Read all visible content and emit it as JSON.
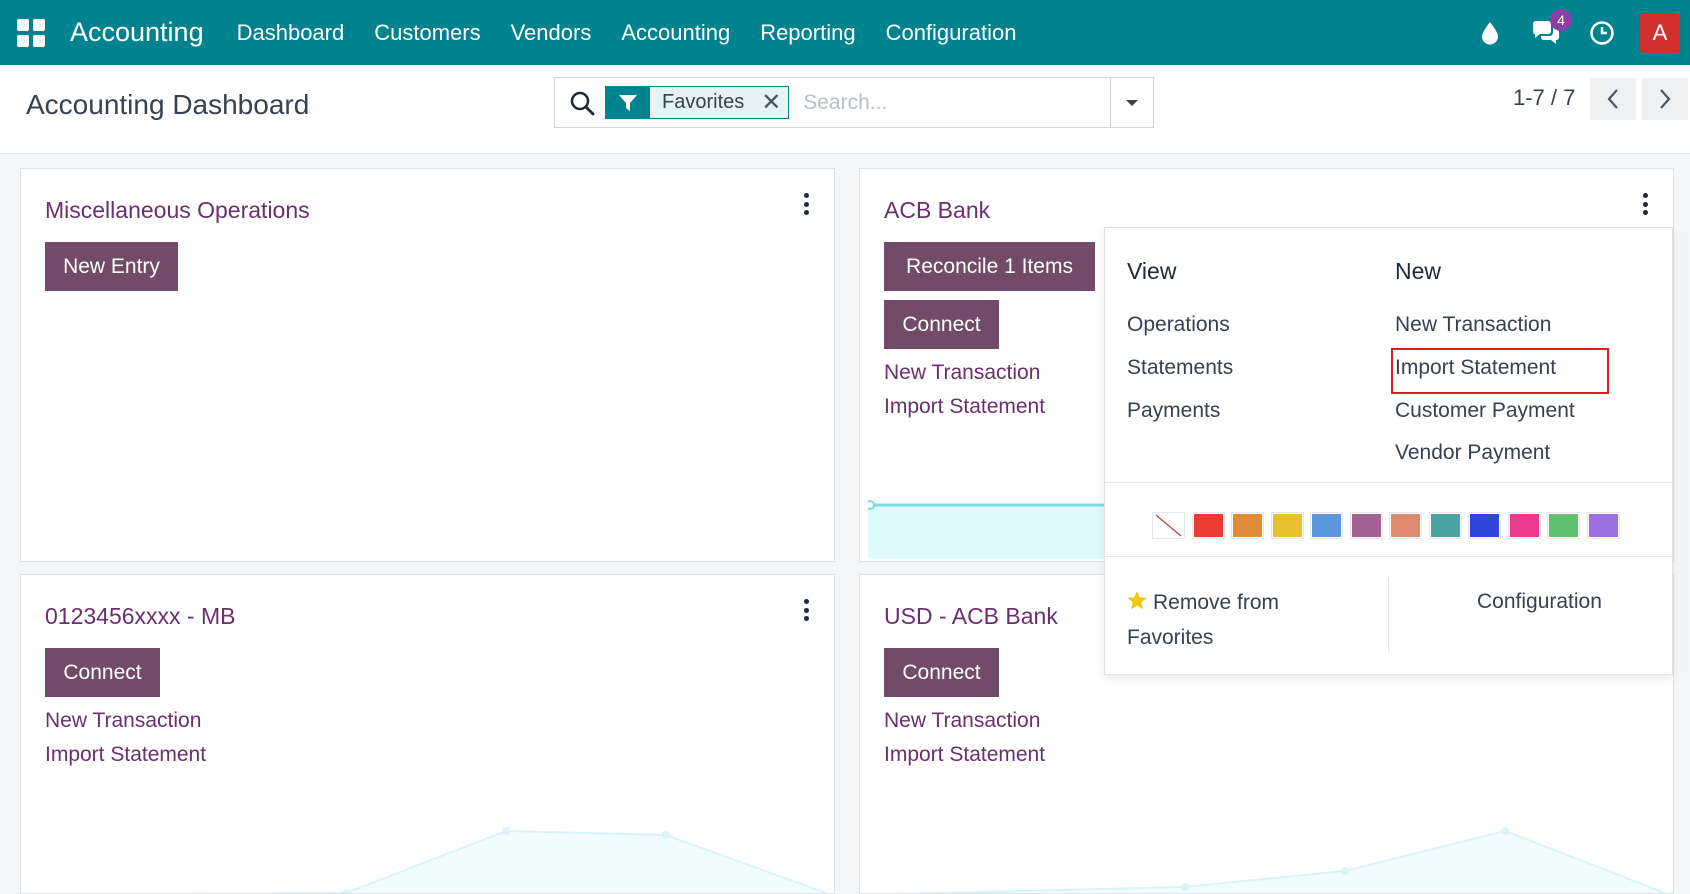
{
  "topbar": {
    "app_name": "Accounting",
    "menu": [
      "Dashboard",
      "Customers",
      "Vendors",
      "Accounting",
      "Reporting",
      "Configuration"
    ],
    "messages_count": "4",
    "avatar_letter": "A",
    "color": "#00838f"
  },
  "control": {
    "title": "Accounting Dashboard",
    "facet_label": "Favorites",
    "search_placeholder": "Search...",
    "pager": "1-7 / 7"
  },
  "cards": {
    "misc": {
      "title": "Miscellaneous Operations",
      "new_entry": "New Entry"
    },
    "acb": {
      "title": "ACB Bank",
      "reconcile": "Reconcile 1 Items",
      "connect": "Connect",
      "new_transaction": "New Transaction",
      "import_statement": "Import Statement"
    },
    "mb": {
      "title": "0123456xxxx - MB",
      "connect": "Connect",
      "new_transaction": "New Transaction",
      "import_statement": "Import Statement"
    },
    "usd": {
      "title": "USD - ACB Bank",
      "connect": "Connect",
      "new_transaction": "New Transaction",
      "import_statement": "Import Statement"
    }
  },
  "dropdown": {
    "view_header": "View",
    "new_header": "New",
    "view_items": [
      "Operations",
      "Statements",
      "Payments"
    ],
    "new_items": [
      "New Transaction",
      "Import Statement",
      "Customer Payment",
      "Vendor Payment"
    ],
    "colors": [
      "#ffffff",
      "#ec3b32",
      "#e08a3a",
      "#e9c02f",
      "#5a97dc",
      "#a26294",
      "#de8a6f",
      "#4aa3a0",
      "#2f47d9",
      "#ea3a8c",
      "#5fc06d",
      "#9b6fe0"
    ],
    "remove_favorites": "Remove from Favorites",
    "configuration": "Configuration"
  },
  "brand_purple": "#714b67"
}
